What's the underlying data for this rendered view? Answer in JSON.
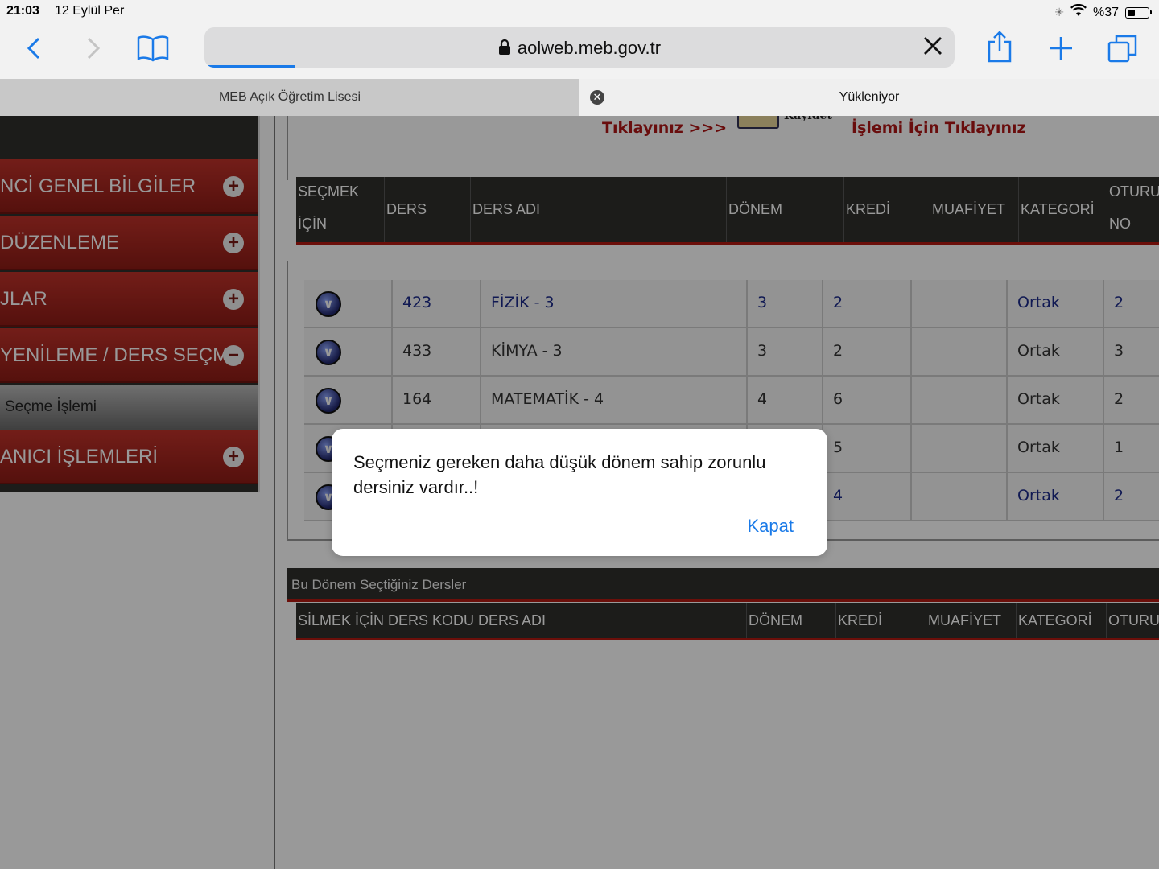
{
  "status_bar": {
    "time": "21:03",
    "date": "12 Eylül Per",
    "battery": "%37",
    "battery_level": 0.37
  },
  "toolbar": {
    "url": "aolweb.meb.gov.tr",
    "load_progress": 0.12
  },
  "tabs": [
    {
      "label": "MEB Açık Öğretim Lisesi"
    },
    {
      "label": "Yükleniyor"
    }
  ],
  "sidebar": {
    "items": [
      {
        "label": "NCİ GENEL BİLGİLER"
      },
      {
        "label": "DÜZENLEME"
      },
      {
        "label": "JLAR"
      },
      {
        "label": " YENİLEME / DERS SEÇME"
      },
      {
        "label": "ANICI İŞLEMLERİ"
      }
    ],
    "subitem": "Seçme İşlemi"
  },
  "banner": {
    "left_text": "Tıklayınız >>>",
    "image_label": "Kayıdet",
    "right_text": "İşlemi İçin Tıklayınız"
  },
  "course_table": {
    "headers": [
      "SEÇMEK İÇİN",
      "DERS KODU",
      "DERS ADI",
      "DÖNEM",
      "KREDİ",
      "MUAFİYET",
      "KATEGORİ",
      "OTURUM NO"
    ],
    "header_display": {
      "h0a": "SEÇMEK",
      "h0b": "İÇİN",
      "h7a": "OTURU",
      "h7b": "NO"
    },
    "rows": [
      {
        "code": "423",
        "name": "FİZİK - 3",
        "donem": "3",
        "kredi": "2",
        "muafiyet": "",
        "kategori": "Ortak",
        "oturum": "2"
      },
      {
        "code": "433",
        "name": "KİMYA - 3",
        "donem": "3",
        "kredi": "2",
        "muafiyet": "",
        "kategori": "Ortak",
        "oturum": "3"
      },
      {
        "code": "164",
        "name": "MATEMATİK - 4",
        "donem": "4",
        "kredi": "6",
        "muafiyet": "",
        "kategori": "Ortak",
        "oturum": "2"
      },
      {
        "code": "",
        "name": "",
        "donem": "",
        "kredi": "5",
        "muafiyet": "",
        "kategori": "Ortak",
        "oturum": "1"
      },
      {
        "code": "",
        "name": "",
        "donem": "",
        "kredi": "4",
        "muafiyet": "",
        "kategori": "Ortak",
        "oturum": "2"
      }
    ]
  },
  "selected_section": {
    "title": "Bu Dönem Seçtiğiniz Dersler",
    "headers": [
      "SİLMEK İÇİN",
      "DERS KODU",
      "DERS ADI",
      "DÖNEM",
      "KREDİ",
      "MUAFİYET",
      "KATEGORİ",
      "OTURU"
    ]
  },
  "dialog": {
    "message": "Seçmeniz gereken daha düşük dönem sahip zorunlu dersiniz vardır..!",
    "button": "Kapat"
  },
  "colors": {
    "accent": "#1a7ae8",
    "menu_red": "#b21a12",
    "header_dark": "#2f302c",
    "banner_red": "#b01717"
  }
}
